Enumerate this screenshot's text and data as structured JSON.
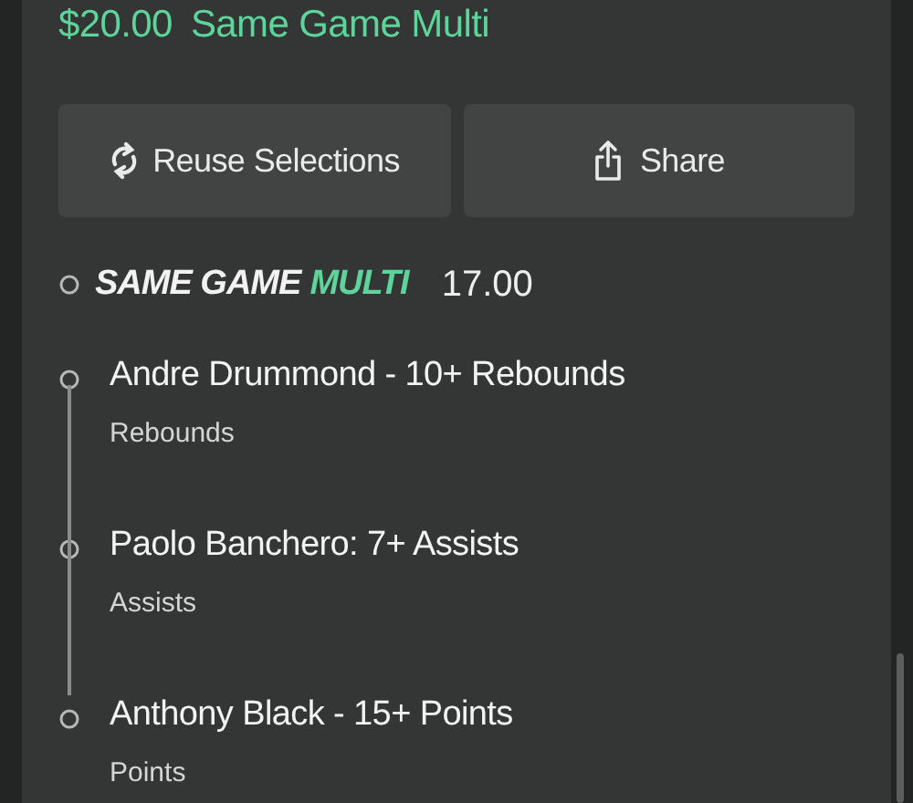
{
  "bet": {
    "stake": "$20.00",
    "type": "Same Game Multi"
  },
  "buttons": [
    {
      "kind": "reuse",
      "label": "Reuse Selections"
    },
    {
      "kind": "share",
      "label": "Share"
    }
  ],
  "multi": {
    "brand_prefix": "SAME GAME",
    "brand_suffix": "MULTI",
    "odds": "17.00"
  },
  "legs": [
    {
      "selection": "Andre Drummond - 10+ Rebounds",
      "market": "Rebounds"
    },
    {
      "selection": "Paolo Banchero: 7+ Assists",
      "market": "Assists"
    },
    {
      "selection": "Anthony Black - 15+ Points",
      "market": "Points"
    }
  ]
}
